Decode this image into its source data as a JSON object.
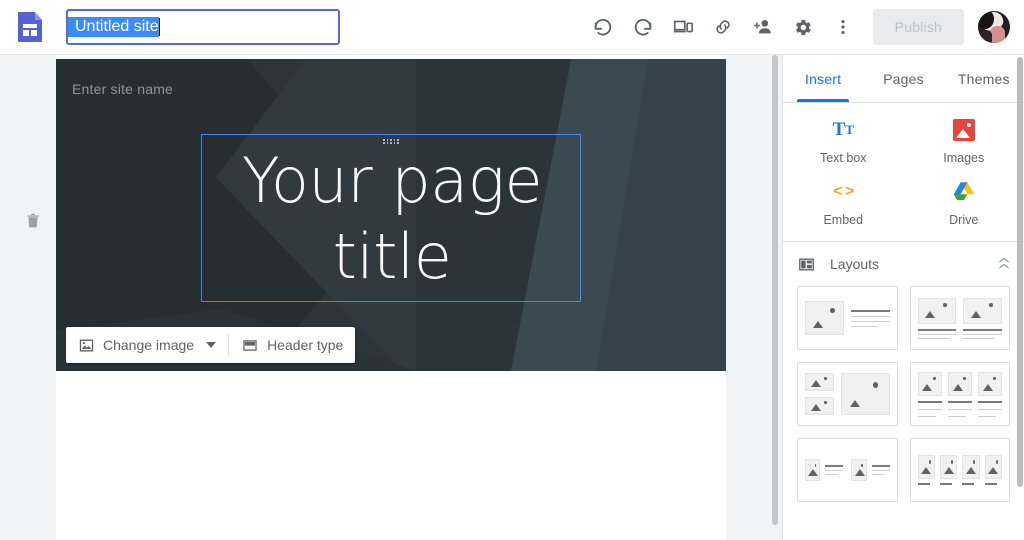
{
  "app": {
    "logo_icon": "google-sites-logo",
    "site_title_value": "Untitled site",
    "site_title_placeholder": "Enter site name"
  },
  "toolbar": {
    "undo_label": "Undo",
    "redo_label": "Redo",
    "preview_label": "Preview",
    "copy_link_label": "Copy page link",
    "share_label": "Add editors",
    "settings_label": "Settings",
    "more_label": "More",
    "publish_label": "Publish",
    "avatar_label": "Account"
  },
  "banner": {
    "site_name_placeholder": "Enter site name",
    "page_title": "Your page title",
    "change_image_label": "Change image",
    "header_type_label": "Header type"
  },
  "gutter": {
    "delete_label": "Delete section"
  },
  "panel": {
    "tabs": [
      {
        "label": "Insert",
        "active": true
      },
      {
        "label": "Pages",
        "active": false
      },
      {
        "label": "Themes",
        "active": false
      }
    ],
    "insert_items": [
      {
        "label": "Text box",
        "icon": "text-box-icon"
      },
      {
        "label": "Images",
        "icon": "images-icon"
      },
      {
        "label": "Embed",
        "icon": "embed-icon"
      },
      {
        "label": "Drive",
        "icon": "drive-icon"
      }
    ],
    "layouts": {
      "title": "Layouts",
      "icon": "layouts-icon",
      "collapse_icon": "chevron-up-icon",
      "options": [
        {
          "name": "image-left-text-right"
        },
        {
          "name": "two-images-with-text"
        },
        {
          "name": "two-small-images-one-large"
        },
        {
          "name": "three-images-with-text"
        },
        {
          "name": "two-image-text-pairs"
        },
        {
          "name": "four-images-row"
        }
      ]
    }
  },
  "colors": {
    "accent_blue": "#1a73e8",
    "selection_blue": "#4285f4",
    "banner_dark": "#2d3538",
    "publish_disabled_bg": "#e9eaec",
    "publish_disabled_text": "#bdc1c6",
    "sites_purple": "#5562d4",
    "images_red": "#e8453c",
    "embed_orange": "#f5a623"
  }
}
